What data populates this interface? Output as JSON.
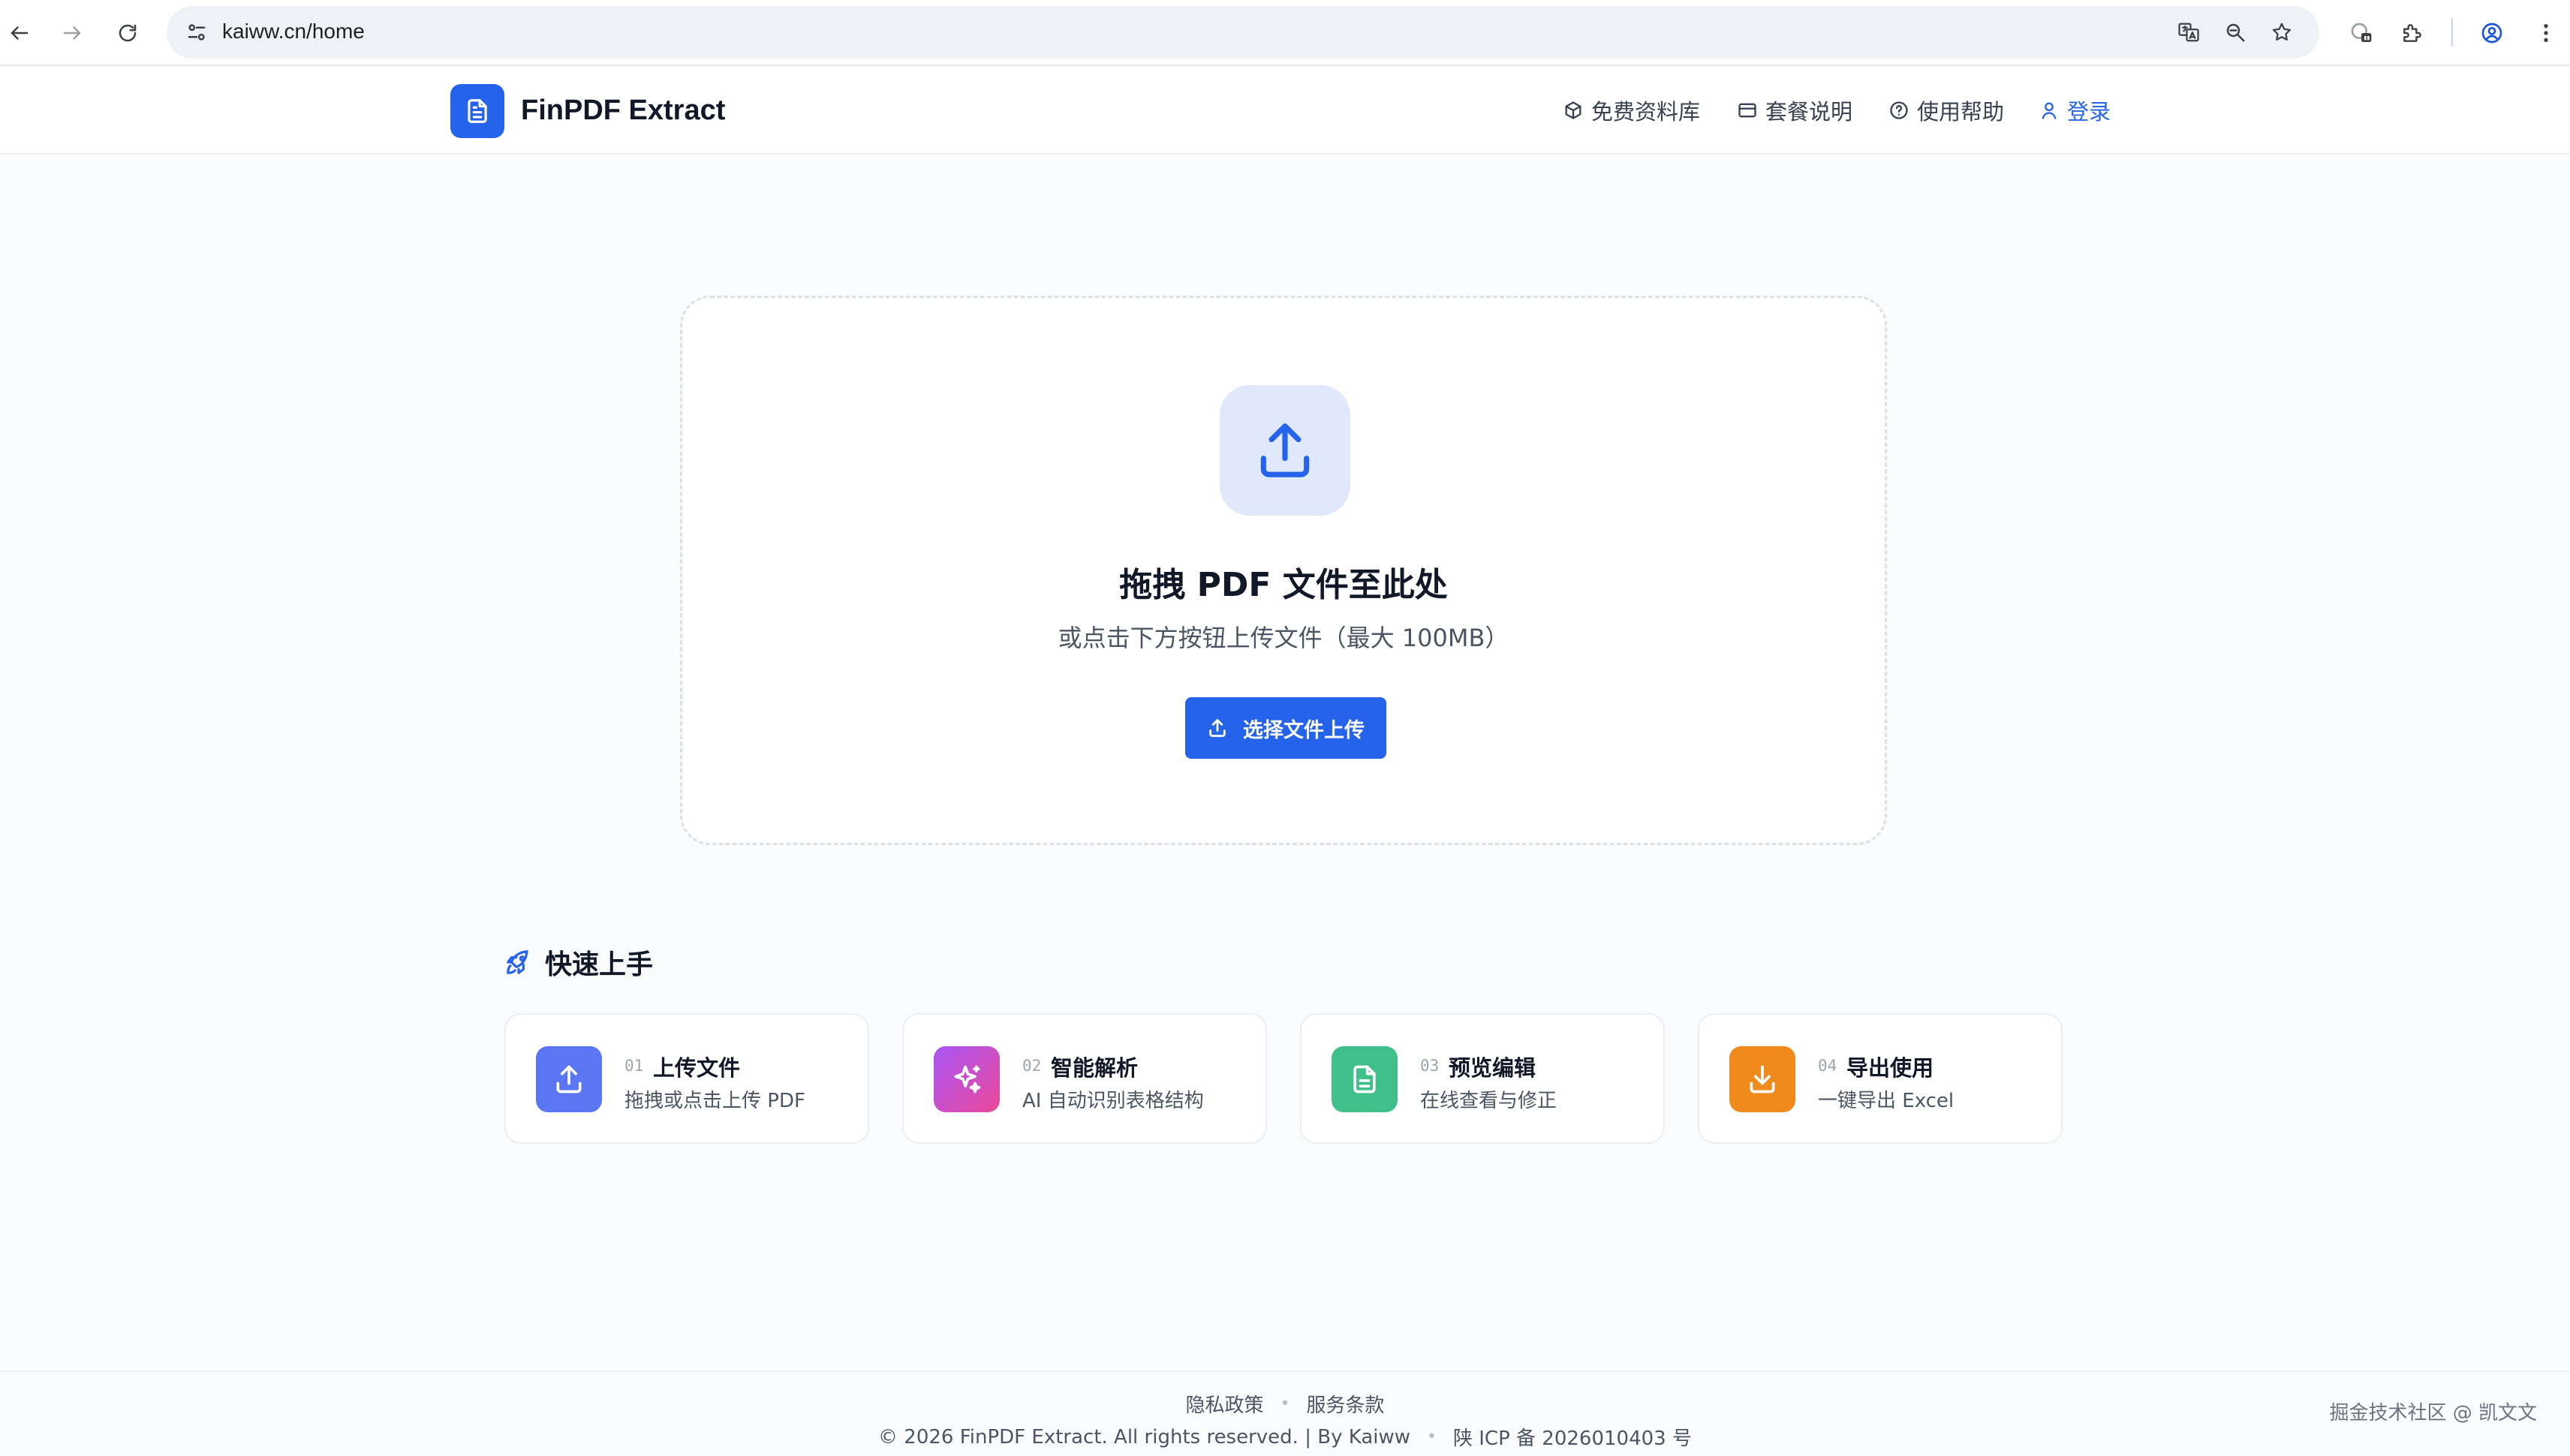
{
  "browser": {
    "url": "kaiww.cn/home"
  },
  "header": {
    "logo_text": "FinPDF Extract",
    "nav": [
      {
        "label": "免费资料库",
        "icon": "cube-icon"
      },
      {
        "label": "套餐说明",
        "icon": "card-icon"
      },
      {
        "label": "使用帮助",
        "icon": "help-circle-icon"
      },
      {
        "label": "登录",
        "icon": "user-icon"
      }
    ]
  },
  "upload": {
    "title": "拖拽 PDF 文件至此处",
    "subtitle": "或点击下方按钮上传文件（最大 100MB）",
    "button_label": "选择文件上传"
  },
  "quick_start": {
    "title": "快速上手",
    "steps": [
      {
        "num": "01",
        "title": "上传文件",
        "desc": "拖拽或点击上传 PDF",
        "color": "#5a76f3",
        "icon": "upload-icon"
      },
      {
        "num": "02",
        "title": "智能解析",
        "desc": "AI 自动识别表格结构",
        "color": "#c84fd3",
        "icon": "sparkles-icon"
      },
      {
        "num": "03",
        "title": "预览编辑",
        "desc": "在线查看与修正",
        "color": "#3fbf8a",
        "icon": "document-icon"
      },
      {
        "num": "04",
        "title": "导出使用",
        "desc": "一键导出 Excel",
        "color": "#f08a1c",
        "icon": "download-icon"
      }
    ]
  },
  "footer": {
    "privacy": "隐私政策",
    "terms": "服务条款",
    "copyright": "© 2026 FinPDF Extract. All rights reserved. | By Kaiww",
    "icp": "陕 ICP 备 2026010403 号",
    "watermark": "掘金技术社区 @ 凯文文"
  },
  "colors": {
    "accent": "#2563eb",
    "upload_icon_bg": "#e0e9fb"
  }
}
